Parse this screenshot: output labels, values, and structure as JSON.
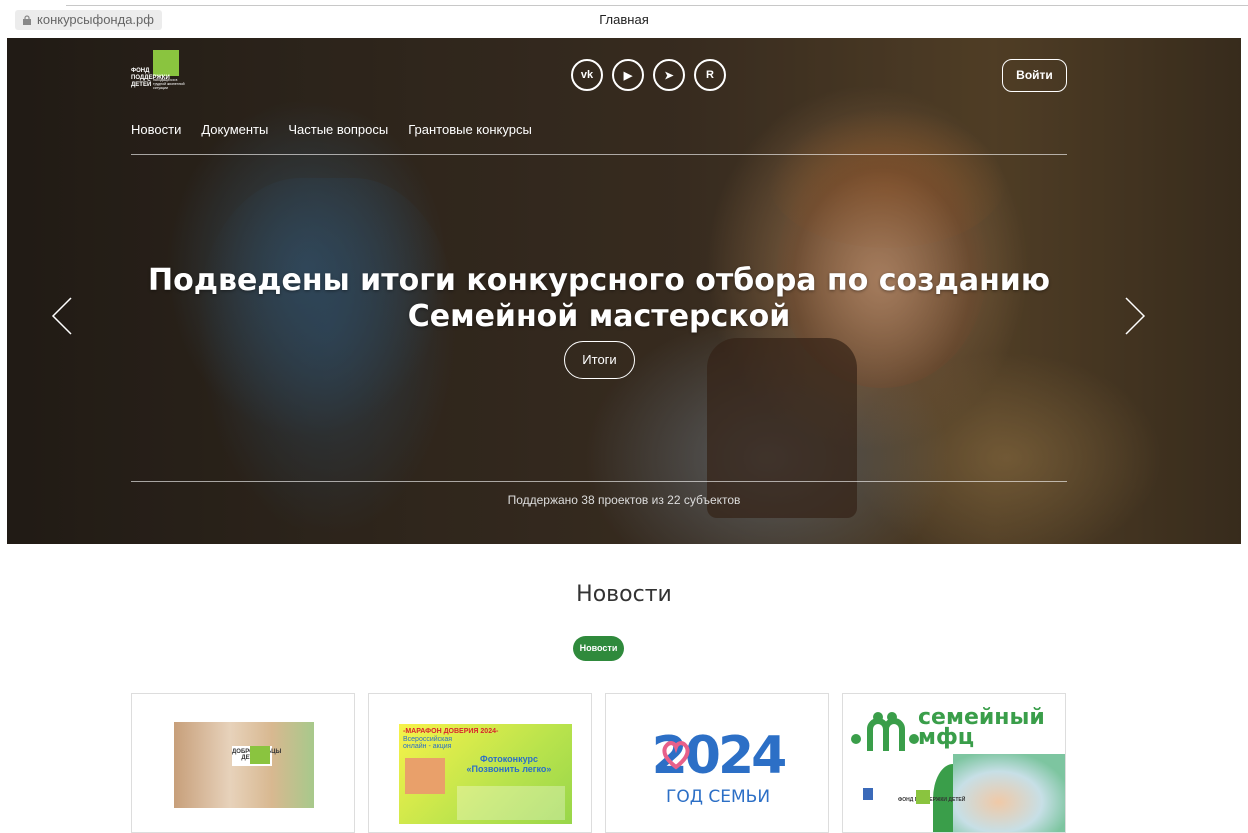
{
  "browser": {
    "url": "конкурсыфонда.рф",
    "title": "Главная"
  },
  "header": {
    "logo_text": "ФОНД ПОДДЕРЖКИ ДЕТЕЙ",
    "logo_sub": "находящихся в трудной жизненной ситуации",
    "socials": [
      {
        "name": "vk-icon",
        "glyph": "vk"
      },
      {
        "name": "youtube-icon",
        "glyph": "▶"
      },
      {
        "name": "telegram-icon",
        "glyph": "➤"
      },
      {
        "name": "rutube-icon",
        "glyph": "R"
      }
    ],
    "login_label": "Войти",
    "nav": [
      "Новости",
      "Документы",
      "Частые вопросы",
      "Грантовые конкурсы"
    ]
  },
  "hero": {
    "headline": "Подведены итоги конкурсного отбора по созданию Семейной мастерской",
    "button_label": "Итоги",
    "stats": "Поддержано 38 проектов из 22 субъектов"
  },
  "news": {
    "title": "Новости",
    "filter_chip": "Новости",
    "cards": [
      {
        "alt": "ДОБРОВОЛЬЦЫ ДЕТЯМ"
      },
      {
        "line1": "-МАРАФОН ДОВЕРИЯ 2024-",
        "line2": "Всероссийская онлайн - акция",
        "line3": "Фотоконкурс «Позвонить легко»"
      },
      {
        "year": "2024",
        "sub": "ГОД СЕМЬИ"
      },
      {
        "title": "семейный мфц",
        "fond": "ФОНД ПОДДЕРЖКИ ДЕТЕЙ"
      }
    ]
  },
  "colors": {
    "accent_green": "#2f8a3c",
    "logo_green": "#8ac43f",
    "blue": "#2c6fc6"
  }
}
